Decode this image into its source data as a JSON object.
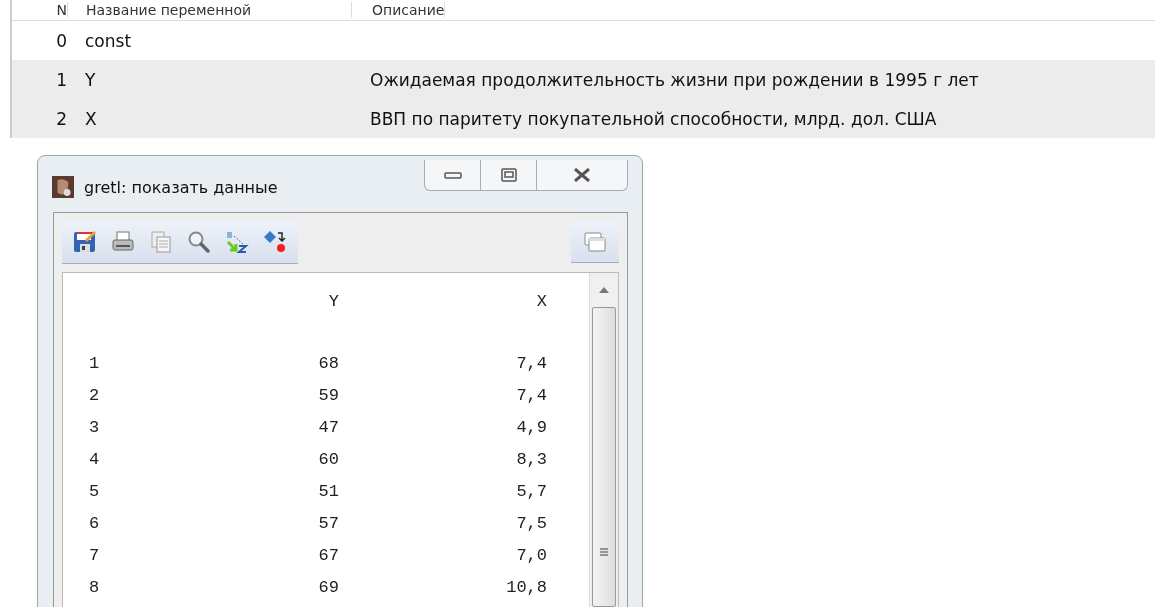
{
  "variable_list": {
    "columns": [
      "N",
      "Название переменной",
      "Описание"
    ],
    "rows": [
      {
        "index": "0",
        "name": "const",
        "description": "",
        "selected": false
      },
      {
        "index": "1",
        "name": "Y",
        "description": "Ожидаемая продолжительность жизни при рождении в 1995 г лет",
        "selected": true
      },
      {
        "index": "2",
        "name": "X",
        "description": "ВВП по паритету покупательной способности, млрд. дол. США",
        "selected": true
      }
    ]
  },
  "data_window": {
    "title": "gretl: показать данные",
    "columns": [
      "",
      "Y",
      "X"
    ],
    "rows": [
      [
        "1",
        "68",
        "7,4"
      ],
      [
        "2",
        "59",
        "7,4"
      ],
      [
        "3",
        "47",
        "4,9"
      ],
      [
        "4",
        "60",
        "8,3"
      ],
      [
        "5",
        "51",
        "5,7"
      ],
      [
        "6",
        "57",
        "7,5"
      ],
      [
        "7",
        "67",
        "7,0"
      ],
      [
        "8",
        "69",
        "10,8"
      ]
    ]
  }
}
